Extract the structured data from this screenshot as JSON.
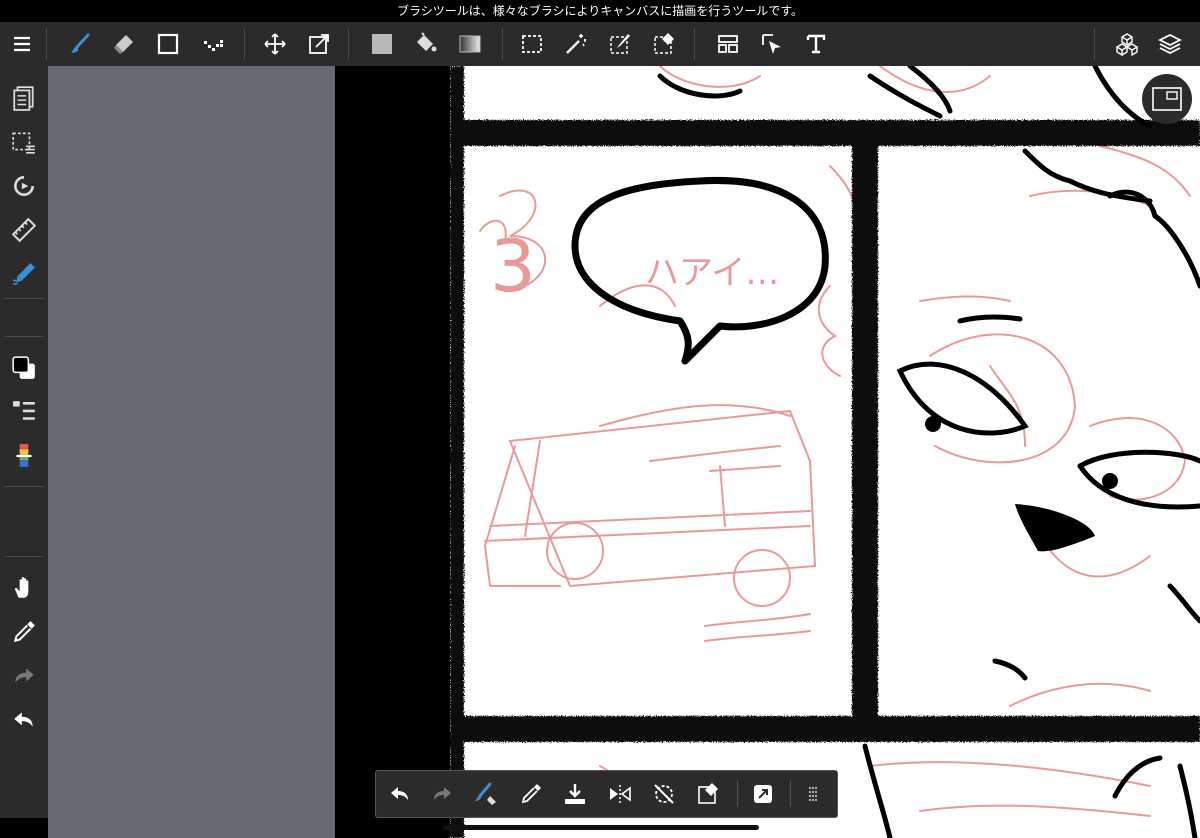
{
  "status_bar": {
    "text": "ブラシツールは、様々なブラシによりキャンバスに描画を行うツールです。"
  },
  "toolbar": {
    "tools": [
      "menu-icon",
      "brush-icon",
      "eraser-icon",
      "shape-icon",
      "dot-icon",
      "move-icon",
      "transform-icon",
      "fill-color-icon",
      "bucket-icon",
      "gradient-icon",
      "select-rect-icon",
      "magic-wand-icon",
      "select-pen-icon",
      "select-eraser-icon",
      "frame-divider-icon",
      "object-select-icon",
      "text-icon",
      "3d-icon",
      "layers-icon"
    ],
    "active_tool": "brush-icon",
    "accent_color": "#3b8fd6"
  },
  "sidebar": {
    "items": [
      "pages-icon",
      "selection-icon",
      "rotate-icon",
      "ruler-icon",
      "snap-icon",
      "color-swatch-icon",
      "brush-list-icon",
      "palette-icon",
      "hand-icon",
      "eyedropper-icon",
      "redo-icon",
      "undo-icon"
    ]
  },
  "canvas": {
    "speech_bubble_text": "ハアイ…",
    "panel_number": "3"
  },
  "bottom_bar": {
    "tools": [
      "undo-icon",
      "redo-icon",
      "brush-swap-icon",
      "eyedropper-icon",
      "download-icon",
      "flip-icon",
      "rotate-reset-icon",
      "clear-icon",
      "fullscreen-icon",
      "grip-icon"
    ]
  }
}
